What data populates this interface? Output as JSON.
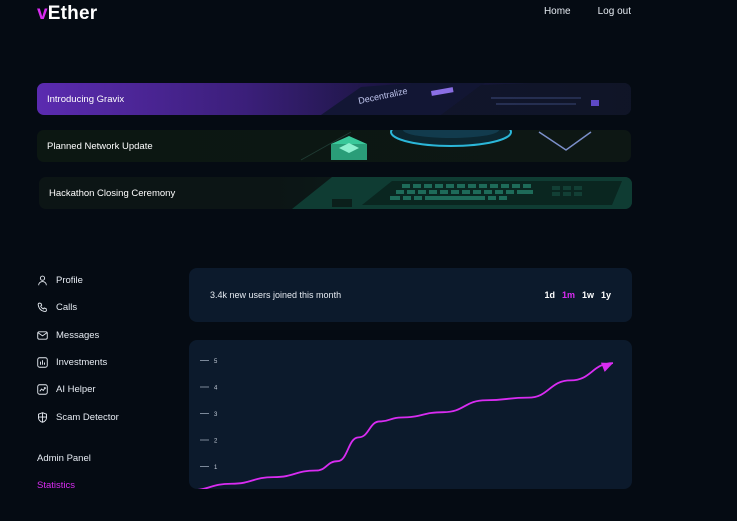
{
  "logo": {
    "v": "v",
    "rest": "Ether"
  },
  "nav": {
    "home": "Home",
    "logout": "Log out"
  },
  "banners": [
    {
      "label": "Introducing Gravix"
    },
    {
      "label": "Planned Network Update"
    },
    {
      "label": "Hackathon Closing Ceremony"
    }
  ],
  "sidebar": {
    "items": [
      {
        "label": "Profile",
        "icon": "user-icon"
      },
      {
        "label": "Calls",
        "icon": "phone-icon"
      },
      {
        "label": "Messages",
        "icon": "mail-icon"
      },
      {
        "label": "Investments",
        "icon": "bar-chart-icon"
      },
      {
        "label": "AI Helper",
        "icon": "trend-icon"
      },
      {
        "label": "Scam Detector",
        "icon": "shield-icon"
      }
    ],
    "admin": "Admin Panel",
    "statistics": "Statistics"
  },
  "stat": {
    "text": "3.4k new users joined this month",
    "ranges": [
      "1d",
      "1m",
      "1w",
      "1y"
    ],
    "active_range": "1m"
  },
  "colors": {
    "accent": "#d92cf2",
    "card": "#0c1a2c",
    "background": "#050b13"
  },
  "chart_data": {
    "type": "line",
    "y_ticks": [
      1,
      2,
      3,
      4,
      5
    ],
    "ylim": [
      0,
      5
    ],
    "grid": false,
    "series": [
      {
        "x": [
          0,
          0.1,
          0.2,
          0.3,
          0.35,
          0.4,
          0.45,
          0.5,
          0.6,
          0.7,
          0.8,
          0.9,
          1.0
        ],
        "values": [
          0.1,
          0.35,
          0.6,
          0.85,
          1.2,
          2.1,
          2.7,
          2.85,
          3.05,
          3.5,
          3.6,
          4.25,
          4.9
        ]
      }
    ]
  }
}
